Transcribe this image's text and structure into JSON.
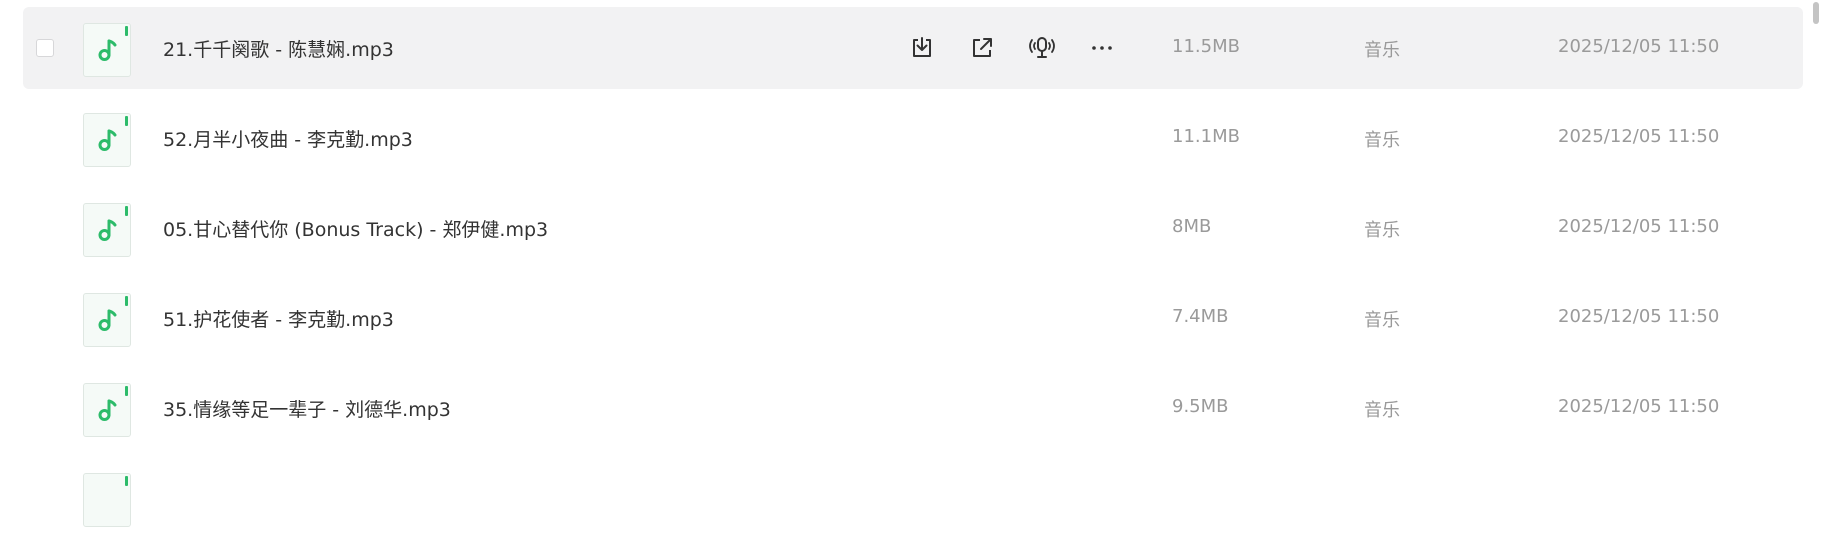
{
  "files": [
    {
      "name": "21.千千阕歌 - 陈慧娴.mp3",
      "size": "11.5MB",
      "type": "音乐",
      "date": "2025/12/05 11:50"
    },
    {
      "name": "52.月半小夜曲 - 李克勤.mp3",
      "size": "11.1MB",
      "type": "音乐",
      "date": "2025/12/05 11:50"
    },
    {
      "name": "05.甘心替代你 (Bonus Track) - 郑伊健.mp3",
      "size": "8MB",
      "type": "音乐",
      "date": "2025/12/05 11:50"
    },
    {
      "name": "51.护花使者 - 李克勤.mp3",
      "size": "7.4MB",
      "type": "音乐",
      "date": "2025/12/05 11:50"
    },
    {
      "name": "35.情缘等足一辈子 - 刘德华.mp3",
      "size": "9.5MB",
      "type": "音乐",
      "date": "2025/12/05 11:50"
    }
  ],
  "row_actions": [
    "download-icon",
    "share-icon",
    "podcast-icon",
    "more-icon"
  ],
  "colors": {
    "accent": "#2dbb6a",
    "hover_row": "#f2f2f3",
    "muted_text": "#9a9a9a"
  }
}
